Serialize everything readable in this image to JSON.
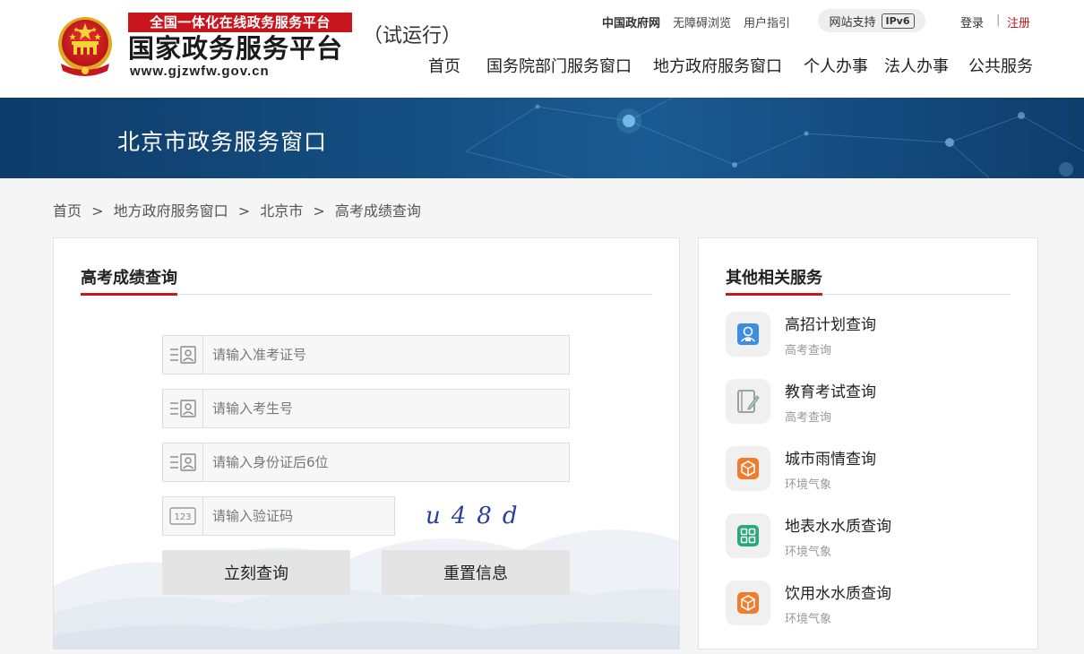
{
  "header": {
    "brand_top": "全国一体化在线政务服务平台",
    "brand_main": "国家政务服务平台",
    "brand_url": "www.gjzwfw.gov.cn",
    "trial": "（试运行）",
    "top_links": [
      "中国政府网",
      "无障碍浏览",
      "用户指引"
    ],
    "ipv6_label": "网站支持",
    "ipv6_badge": "IPv6",
    "login": "登录",
    "separator": "|",
    "register": "注册",
    "nav": [
      "首页",
      "国务院部门服务窗口",
      "地方政府服务窗口",
      "个人办事",
      "法人办事",
      "公共服务"
    ]
  },
  "banner": {
    "title": "北京市政务服务窗口"
  },
  "breadcrumb": [
    "首页",
    ">",
    "地方政府服务窗口",
    ">",
    "北京市",
    ">",
    "高考成绩查询"
  ],
  "query": {
    "title": "高考成绩查询",
    "fields": [
      {
        "placeholder": "请输入准考证号",
        "value": ""
      },
      {
        "placeholder": "请输入考生号",
        "value": ""
      },
      {
        "placeholder": "请输入身份证后6位",
        "value": ""
      },
      {
        "placeholder": "请输入验证码",
        "value": ""
      }
    ],
    "captcha_icon_text": "123",
    "captcha_text": "u48d",
    "submit_label": "立刻查询",
    "reset_label": "重置信息"
  },
  "related": {
    "title": "其他相关服务",
    "items": [
      {
        "name": "高招计划查询",
        "category": "高考查询",
        "icon": "person-card-icon",
        "color": "#3d8de0"
      },
      {
        "name": "教育考试查询",
        "category": "高考查询",
        "icon": "notebook-pen-icon",
        "color": "#9aa5a0"
      },
      {
        "name": "城市雨情查询",
        "category": "环境气象",
        "icon": "box-icon",
        "color": "#f07c2c"
      },
      {
        "name": "地表水水质查询",
        "category": "环境气象",
        "icon": "grid-icon",
        "color": "#2aa876"
      },
      {
        "name": "饮用水水质查询",
        "category": "环境气象",
        "icon": "box-icon",
        "color": "#f07c2c"
      }
    ]
  }
}
